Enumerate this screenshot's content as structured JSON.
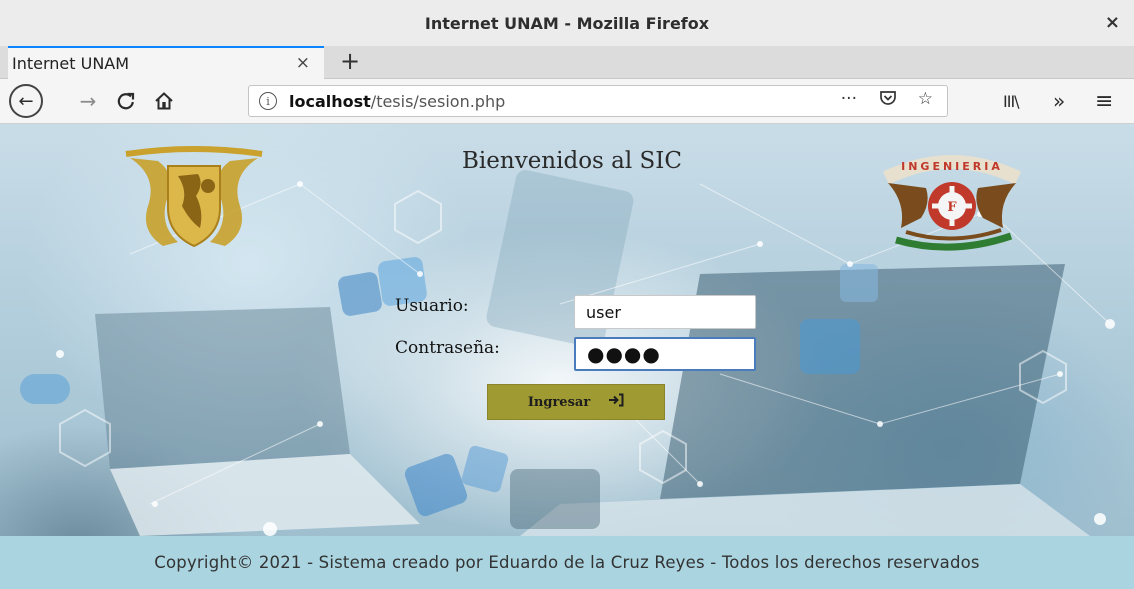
{
  "window": {
    "title": "Internet UNAM - Mozilla Firefox",
    "close_glyph": "×"
  },
  "tabs": [
    {
      "label": "Internet UNAM",
      "close_glyph": "×"
    }
  ],
  "new_tab_glyph": "+",
  "nav": {
    "back_glyph": "←",
    "forward_glyph": "→",
    "reload_glyph": "C",
    "url_host": "localhost",
    "url_path": "/tesis/sesion.php",
    "info_glyph": "i",
    "page_actions_glyph": "···",
    "bookmark_glyph": "☆",
    "library_glyph": "III\\",
    "overflow_glyph": "»",
    "menu_glyph": "≡"
  },
  "page": {
    "heading": "Bienvenidos al SIC",
    "form": {
      "user_label": "Usuario:",
      "user_value": "user",
      "password_label": "Contraseña:",
      "password_value": "●●●●",
      "submit_label": "Ingresar",
      "submit_icon_glyph": "➜]"
    },
    "logos": {
      "left": "unam-shield",
      "right": "ingenieria-shield",
      "right_text": "INGENIERIA"
    },
    "footer": "Copyright© 2021 - Sistema creado por Eduardo de la Cruz Reyes - Todos los derechos reservados"
  },
  "colors": {
    "accent_tab": "#0a84ff",
    "submit_button": "#9f9a32",
    "footer_bg": "#a9d4e0",
    "focus_border": "#4a7bbd"
  }
}
